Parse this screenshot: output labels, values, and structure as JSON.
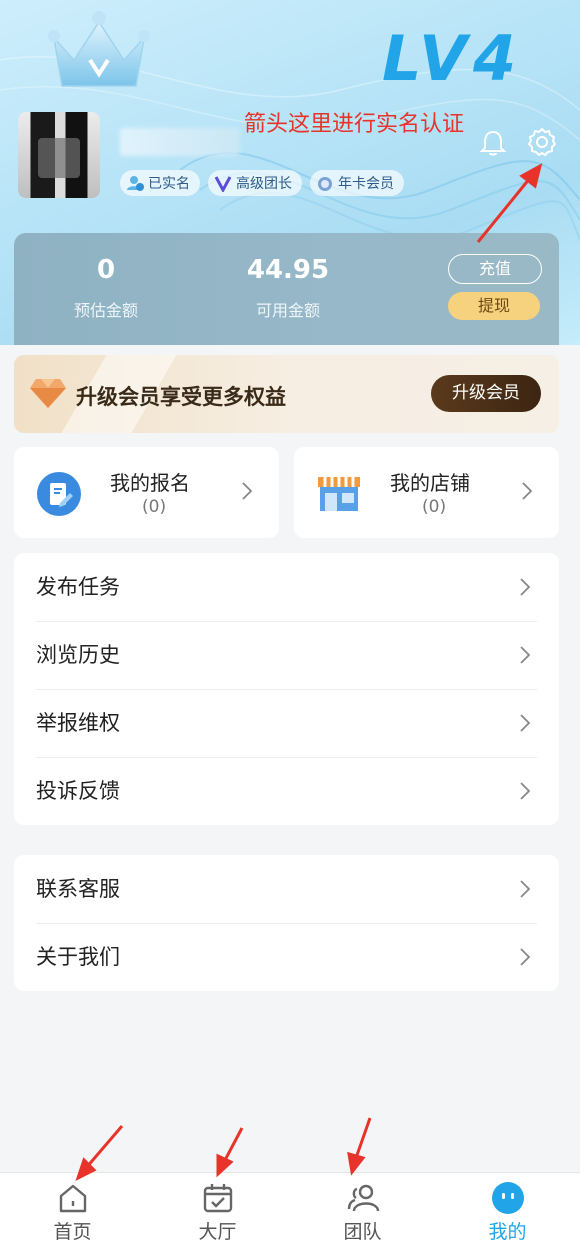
{
  "header": {
    "level_badge": "LV4",
    "annotation": "箭头这里进行实名认证",
    "badges": [
      {
        "label": "已实名",
        "icon": "verified-user-icon"
      },
      {
        "label": "高级团长",
        "icon": "v-icon"
      },
      {
        "label": "年卡会员",
        "icon": "medal-icon"
      }
    ]
  },
  "balance": {
    "estimated_value": "0",
    "estimated_label": "预估金额",
    "available_value": "44.95",
    "available_label": "可用金额",
    "recharge_label": "充值",
    "withdraw_label": "提现"
  },
  "vip": {
    "text": "升级会员享受更多权益",
    "button": "升级会员"
  },
  "cards": [
    {
      "title": "我的报名",
      "count": "(0)"
    },
    {
      "title": "我的店铺",
      "count": "(0)"
    }
  ],
  "menu1": [
    "发布任务",
    "浏览历史",
    "举报维权",
    "投诉反馈"
  ],
  "menu2": [
    "联系客服",
    "关于我们"
  ],
  "tabbar": [
    {
      "label": "首页",
      "icon": "home-icon"
    },
    {
      "label": "大厅",
      "icon": "calendar-check-icon"
    },
    {
      "label": "团队",
      "icon": "team-icon"
    },
    {
      "label": "我的",
      "icon": "profile-face-icon",
      "active": true
    }
  ],
  "colors": {
    "accent": "#22a5e8",
    "annotation_red": "#e8332a",
    "withdraw_gold": "#f7d27e",
    "vip_brown": "#4a2e16"
  }
}
